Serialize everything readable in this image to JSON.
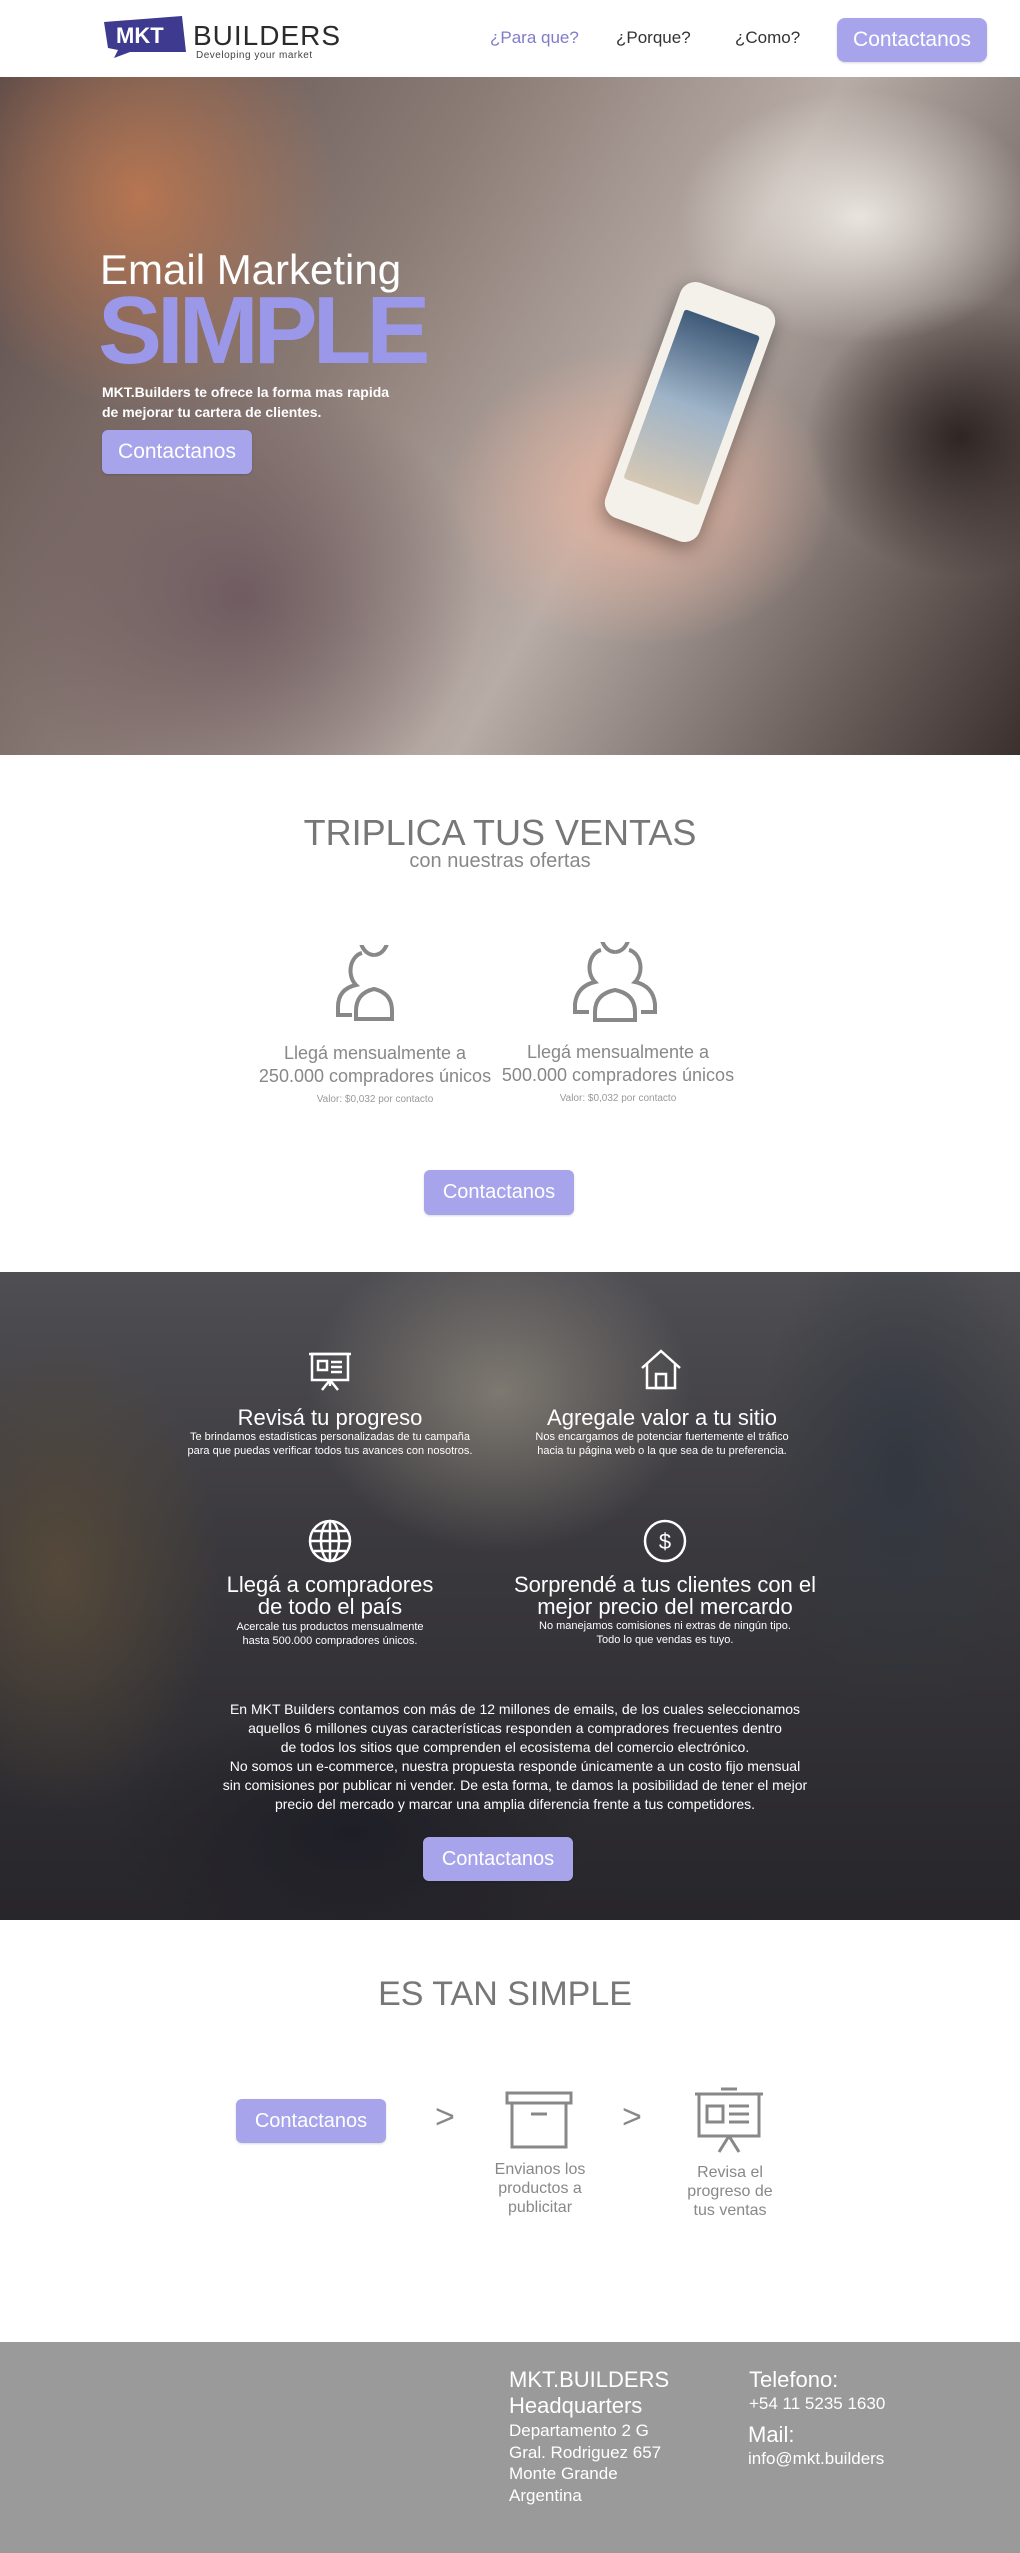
{
  "brand": {
    "logo_badge": "MKT",
    "logo_text": "BUILDERS",
    "tagline": "Developing your market",
    "accent_color": "#a7a4ec"
  },
  "nav": {
    "items": [
      "¿Para que?",
      "¿Porque?",
      "¿Como?"
    ],
    "contact_label": "Contactanos"
  },
  "hero": {
    "subtitle": "Email Marketing",
    "title": "SIMPLE",
    "description": "MKT.Builders te ofrece la  forma mas rapida de mejorar tu cartera de clientes.",
    "button_label": "Contactanos"
  },
  "triplica": {
    "title": "TRIPLICA TUS VENTAS",
    "subtitle": "con nuestras ofertas",
    "offers": [
      {
        "icon": "two-users-icon",
        "text_line1": "Llegá mensualmente a",
        "text_line2": "250.000 compradores únicos",
        "value": "Valor: $0,032 por contacto"
      },
      {
        "icon": "three-users-icon",
        "text_line1": "Llegá mensualmente a",
        "text_line2": "500.000 compradores únicos",
        "value": "Valor: $0,032 por contacto"
      }
    ],
    "button_label": "Contactanos"
  },
  "features": {
    "items": [
      {
        "icon": "presentation-board-icon",
        "title": "Revisá tu progreso",
        "desc_line1": "Te brindamos estadísticas personalizadas de tu campaña",
        "desc_line2": "para que puedas verificar todos tus avances con nosotros."
      },
      {
        "icon": "house-icon",
        "title": "Agregale valor a tu sitio",
        "desc_line1": "Nos encargamos de potenciar fuertemente el tráfico",
        "desc_line2": "hacia tu página web o la que sea de tu preferencia."
      },
      {
        "icon": "globe-icon",
        "title_line1": "Llegá a compradores",
        "title_line2": "de todo el país",
        "desc_line1": "Acercale tus productos mensualmente",
        "desc_line2": "hasta 500.000 compradores únicos."
      },
      {
        "icon": "dollar-coin-icon",
        "title_line1": "Sorprendé a tus clientes con el",
        "title_line2": "mejor precio del mercardo",
        "desc_line1": "No manejamos comisiones ni extras de ningún tipo.",
        "desc_line2": "Todo lo que vendas es tuyo."
      }
    ],
    "paragraph_lines": [
      "En MKT Builders contamos con más de 12 millones de emails, de los cuales seleccionamos",
      "aquellos 6 millones cuyas características responden a compradores frecuentes dentro",
      "de todos los sitios  que comprenden el ecosistema del comercio electrónico.",
      "No somos un e-commerce, nuestra propuesta responde únicamente a un costo fijo mensual",
      "sin comisiones por publicar ni vender. De esta forma, te damos la posibilidad de tener el mejor",
      "precio del mercado y marcar una amplia diferencia frente a tus competidores."
    ],
    "button_label": "Contactanos"
  },
  "simple": {
    "title": "ES TAN SIMPLE",
    "button_label": "Contactanos",
    "arrow": ">",
    "steps": [
      {
        "icon": "archive-box-icon",
        "line1": "Envianos los",
        "line2": "productos a",
        "line3": "publicitar"
      },
      {
        "icon": "presentation-board-icon",
        "line1": "Revisa el",
        "line2": "progreso de",
        "line3": "tus ventas"
      }
    ]
  },
  "footer": {
    "company": "MKT.BUILDERS",
    "hq": "Headquarters",
    "address": [
      "Departamento 2 G",
      "Gral. Rodriguez 657",
      "Monte Grande",
      "Argentina"
    ],
    "phone_label": "Telefono:",
    "phone": "+54 11 5235 1630",
    "mail_label": "Mail:",
    "mail": "info@mkt.builders"
  }
}
